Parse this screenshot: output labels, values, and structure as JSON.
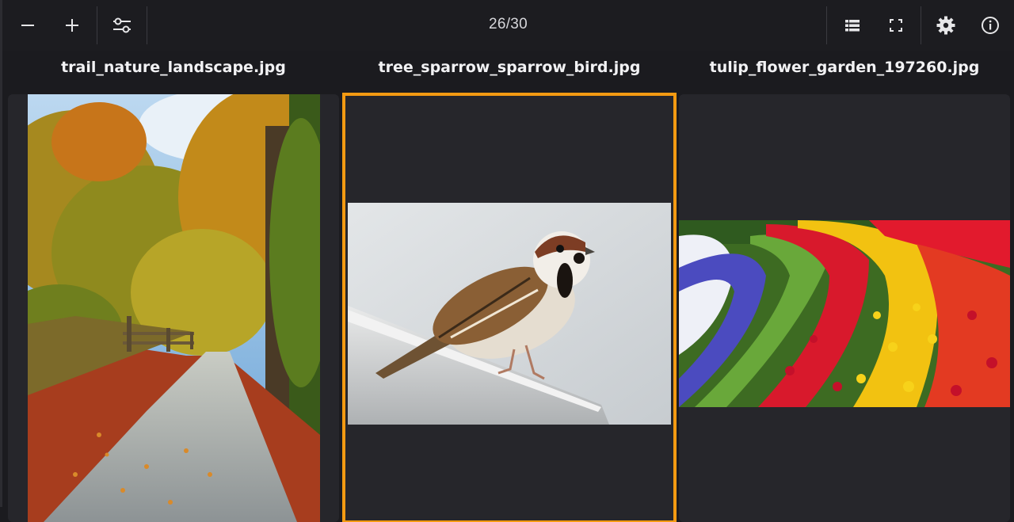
{
  "toolbar": {
    "counter": "26/30",
    "left_buttons": [
      {
        "icon": "minus-icon",
        "label": "Zoom out"
      },
      {
        "icon": "plus-icon",
        "label": "Zoom in"
      },
      {
        "icon": "sliders-icon",
        "label": "Adjust"
      }
    ],
    "right_buttons": [
      {
        "icon": "list-view-icon"
      },
      {
        "icon": "fullscreen-icon"
      },
      {
        "icon": "gear-icon"
      },
      {
        "icon": "info-icon"
      }
    ]
  },
  "images": [
    {
      "filename": "trail_nature_landscape.jpg",
      "selected": false,
      "subject": "autumn forest trail"
    },
    {
      "filename": "tree_sparrow_sparrow_bird.jpg",
      "selected": true,
      "subject": "sparrow on ledge"
    },
    {
      "filename": "tulip_flower_garden_197260.jpg",
      "selected": false,
      "subject": "tulip garden rows"
    }
  ],
  "colors": {
    "background": "#1b1b1f",
    "panel": "#26262b",
    "selection": "#f39a12"
  }
}
